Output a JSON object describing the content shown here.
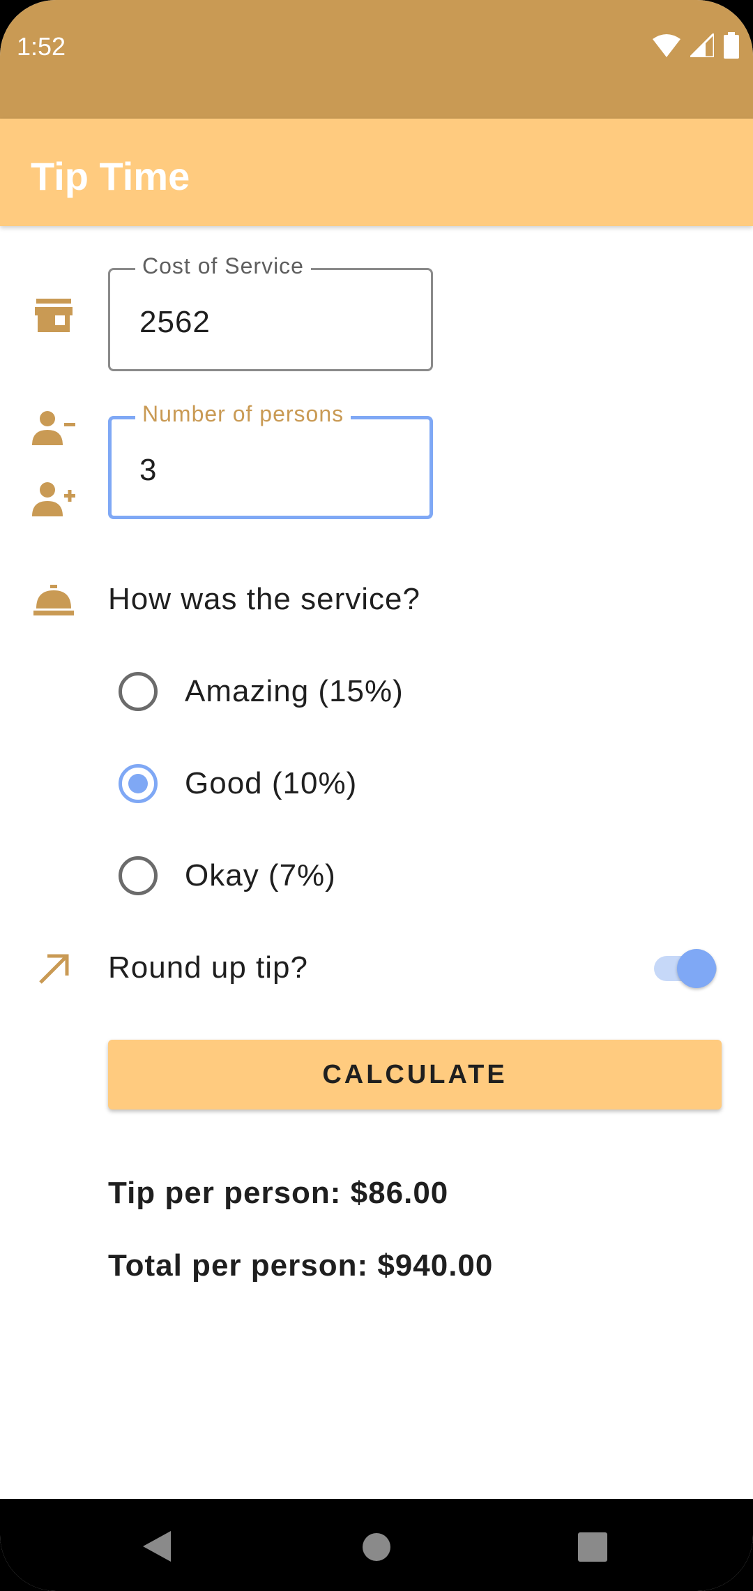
{
  "status_bar": {
    "time": "1:52",
    "icons": [
      "wifi-icon",
      "signal-icon",
      "battery-icon"
    ]
  },
  "app_bar": {
    "title": "Tip Time"
  },
  "cost_field": {
    "label": "Cost of Service",
    "value": "2562",
    "icon": "storefront-icon"
  },
  "persons_field": {
    "label": "Number of persons",
    "value": "3",
    "icons": [
      "person-remove-icon",
      "person-add-icon"
    ]
  },
  "service": {
    "question": "How was the service?",
    "icon": "room-service-icon",
    "options": [
      {
        "label": "Amazing (15%)",
        "selected": false
      },
      {
        "label": "Good (10%)",
        "selected": true
      },
      {
        "label": "Okay (7%)",
        "selected": false
      }
    ]
  },
  "round_up": {
    "label": "Round up tip?",
    "enabled": true,
    "icon": "arrow-up-right-icon"
  },
  "calculate_button": {
    "label": "CALCULATE"
  },
  "results": {
    "tip": "Tip per person: $86.00",
    "total": "Total per person: $940.00"
  },
  "nav_bar": {
    "icons": [
      "back-icon",
      "home-icon",
      "recents-icon"
    ]
  },
  "colors": {
    "status_bar": "#C99A54",
    "app_bar": "#FFCB7F",
    "accent": "#7FA8F5",
    "icon": "#C99A54"
  }
}
